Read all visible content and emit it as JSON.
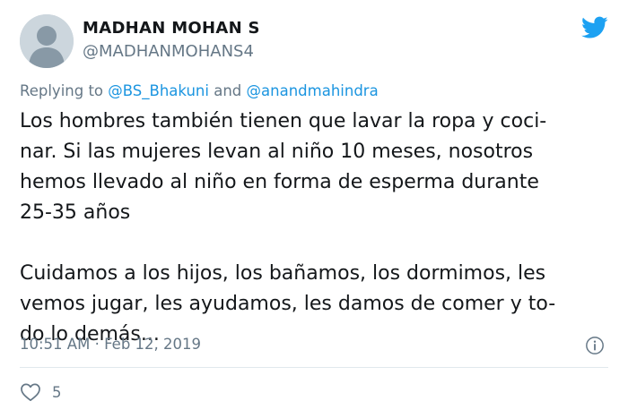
{
  "user": {
    "display_name": "MADHAN MOHAN S",
    "handle": "@MADHANMOHANS4"
  },
  "reply": {
    "prefix": "Replying to ",
    "mention_1": "@BS_Bhakuni",
    "joiner": " and ",
    "mention_2": "@anandmahindra"
  },
  "tweet": {
    "lines": [
      "Los hombres también tienen que lavar la ropa y coci-",
      "nar. Si las mujeres levan al niño 10 meses, nosotros",
      "hemos llevado al niño en forma de esperma durante",
      "25-35 años",
      "Cuidamos a los hijos, los bañamos, los dormimos, les",
      "vemos jugar, les ayudamos, les damos de comer y to-",
      "do lo demás..."
    ]
  },
  "meta": {
    "time": "10:51 AM",
    "separator": " · ",
    "date": "Feb 12, 2019"
  },
  "actions": {
    "like_count": "5"
  },
  "icons": {
    "avatar": "default-avatar-icon",
    "brand": "twitter-bird-icon",
    "info": "info-icon",
    "like": "heart-icon"
  },
  "colors": {
    "brand_blue": "#1da1f2",
    "link_blue": "#1b95e0",
    "secondary_text": "#657786",
    "divider": "#e1e8ed"
  }
}
